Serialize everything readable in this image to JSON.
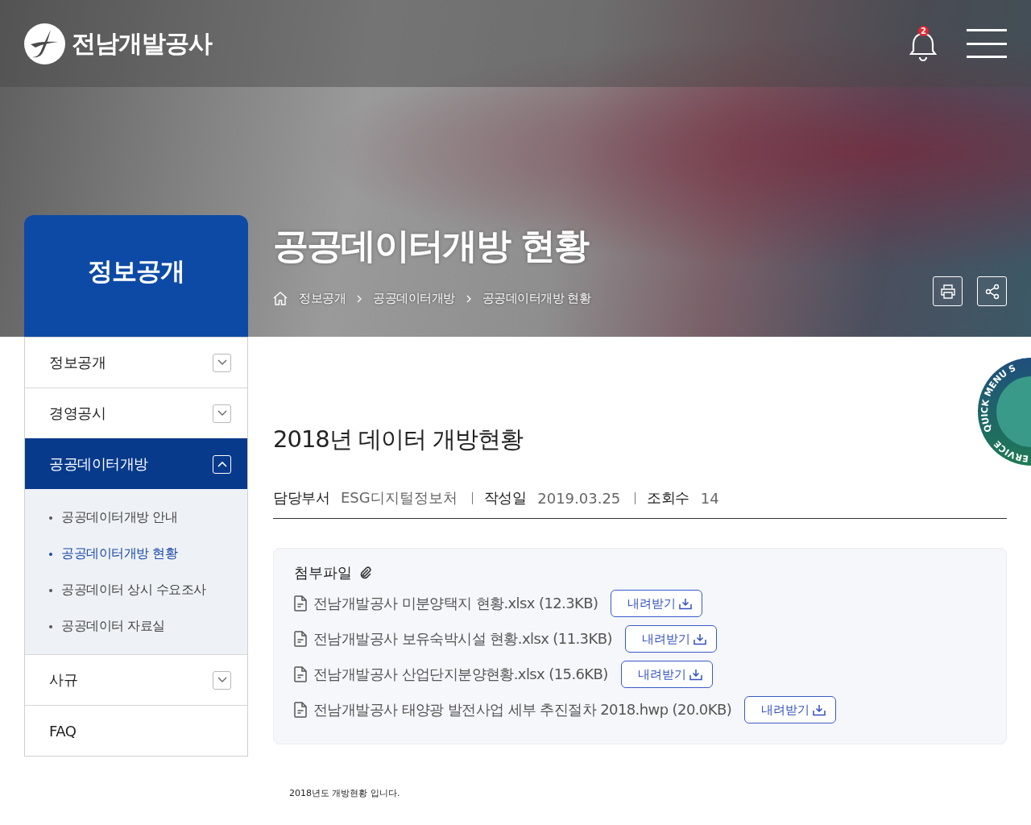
{
  "header": {
    "logo": "전남개발공사",
    "notification_count": "2"
  },
  "hero": {
    "section_title": "정보공개",
    "page_title": "공공데이터개방 현황",
    "breadcrumb": [
      "정보공개",
      "공공데이터개방",
      "공공데이터개방 현황"
    ]
  },
  "sidebar": {
    "items": [
      {
        "label": "정보공개",
        "kind": "group",
        "expanded": false,
        "selected": false
      },
      {
        "label": "경영공시",
        "kind": "group",
        "expanded": false,
        "selected": false
      },
      {
        "label": "공공데이터개방",
        "kind": "group",
        "expanded": true,
        "selected": true,
        "children": [
          {
            "label": "공공데이터개방 안내",
            "selected": false
          },
          {
            "label": "공공데이터개방 현황",
            "selected": true
          },
          {
            "label": "공공데이터 상시 수요조사",
            "selected": false
          },
          {
            "label": "공공데이터 자료실",
            "selected": false
          }
        ]
      },
      {
        "label": "사규",
        "kind": "group",
        "expanded": false,
        "selected": false
      },
      {
        "label": "FAQ",
        "kind": "link",
        "selected": false
      }
    ]
  },
  "post": {
    "title": "2018년 데이터 개방현황",
    "meta": [
      {
        "label": "담당부서",
        "value": "ESG디지털정보처"
      },
      {
        "label": "작성일",
        "value": "2019.03.25"
      },
      {
        "label": "조회수",
        "value": "14"
      }
    ],
    "attachments": {
      "label": "첨부파일",
      "files": [
        {
          "name": "전남개발공사 미분양택지 현황.xlsx (12.3KB)",
          "button": "내려받기"
        },
        {
          "name": "전남개발공사 보유숙박시설 현황.xlsx (11.3KB)",
          "button": "내려받기"
        },
        {
          "name": "전남개발공사 산업단지분양현황.xlsx (15.6KB)",
          "button": "내려받기"
        },
        {
          "name": "전남개발공사 태양광 발전사업 세부 추진절차 2018.hwp (20.0KB)",
          "button": "내려받기"
        }
      ]
    },
    "body": "2018년도 개방현황 입니다."
  },
  "quick_menu": {
    "label_top": "QUICK MENU S",
    "label_bottom": "ERVICE"
  }
}
